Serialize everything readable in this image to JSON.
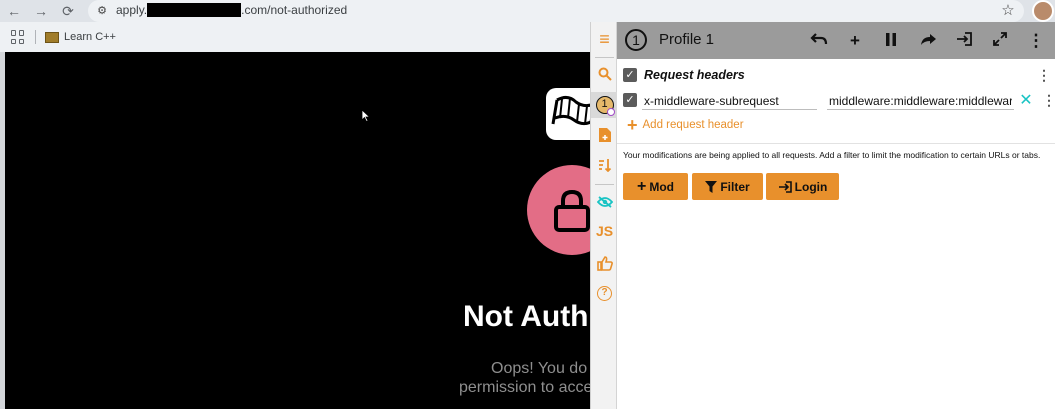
{
  "browser": {
    "url_prefix": "apply.",
    "url_suffix": ".com/not-authorized",
    "nav_back": "←",
    "nav_forward": "→",
    "nav_reload": "⟳",
    "bookmark_star": "☆",
    "site_settings_icon": "⚙"
  },
  "bookmarks": {
    "items": [
      {
        "label": "Learn C++"
      }
    ]
  },
  "site": {
    "title": "Not Auth",
    "text_line1": "Oops! You do",
    "text_line2": "permission to acce"
  },
  "extension": {
    "profile": {
      "number": "1",
      "name": "Profile 1"
    },
    "header_buttons": [
      {
        "name": "undo-icon",
        "glyph": "↶"
      },
      {
        "name": "add-icon",
        "glyph": "+"
      },
      {
        "name": "pause-icon",
        "glyph": "❚❚"
      },
      {
        "name": "share-icon",
        "glyph": "➦"
      },
      {
        "name": "login-icon",
        "glyph": "⇥"
      },
      {
        "name": "expand-icon",
        "glyph": "⤢"
      },
      {
        "name": "more-vert-icon",
        "glyph": "⋮"
      }
    ],
    "sidebar": {
      "menu_icon": "≡",
      "search_icon": "⚲",
      "profile_badge": "1",
      "add_profile_icon": "🗎",
      "sort_icon": "⇅",
      "visibility_icon": "◉",
      "js_label": "JS",
      "thumbs_icon": "👍",
      "help_icon": "?"
    },
    "request_headers": {
      "title": "Request headers",
      "checked": "✓",
      "rows": [
        {
          "name": "x-middleware-subrequest",
          "value": "middleware:middleware:middleware:middleware:middleware"
        }
      ],
      "add_label": "Add request header",
      "add_glyph": "+",
      "remove_glyph": "✕"
    },
    "note": "Your modifications are being applied to all requests. Add a filter to limit the modification to certain URLs or tabs.",
    "actions": [
      {
        "label": "Mod",
        "glyph": "+"
      },
      {
        "label": "Filter",
        "glyph": "▼"
      },
      {
        "label": "Login",
        "glyph": "⇥"
      }
    ],
    "kebab": "⋮"
  },
  "colors": {
    "accent": "#e8902c",
    "header_bg": "#9b9b9b",
    "remove_x": "#19c4c4",
    "lock_circle": "#e36d86"
  }
}
